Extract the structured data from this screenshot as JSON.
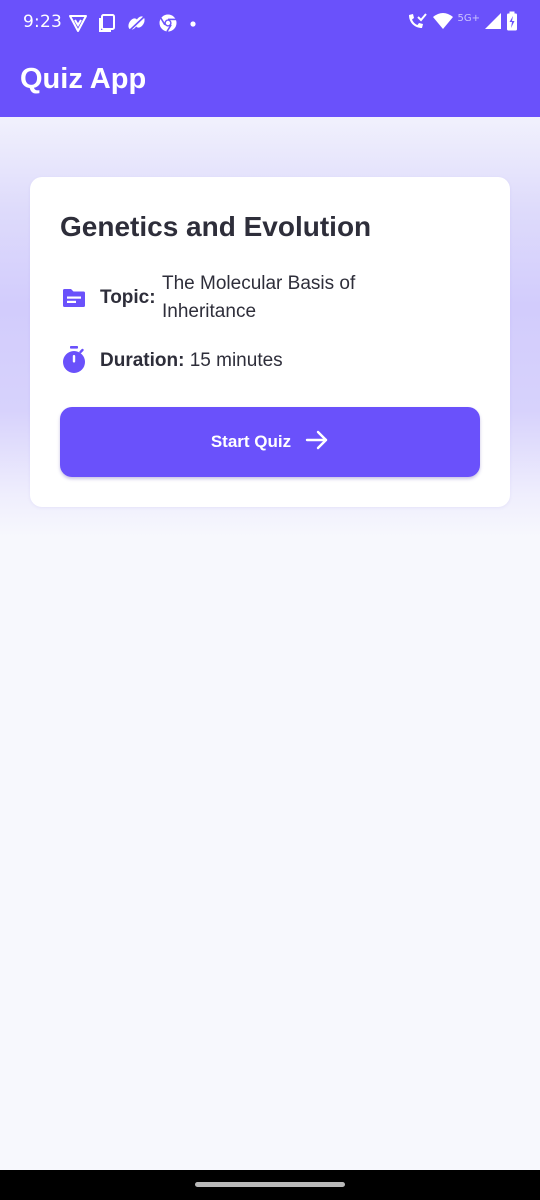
{
  "status_bar": {
    "time": "9:23",
    "network_label": "5G+",
    "left_icons": [
      "vpn-shield-icon",
      "screen-icon",
      "leaf-app-icon",
      "chrome-icon",
      "notification-dot-icon"
    ],
    "right_icons": [
      "wifi-calling-icon",
      "wifi-icon",
      "signal-icon",
      "battery-charging-icon"
    ]
  },
  "app_bar": {
    "title": "Quiz App"
  },
  "quiz_card": {
    "title": "Genetics and Evolution",
    "topic_label": "Topic:",
    "topic_value": "The Molecular Basis of Inheritance",
    "duration_label": "Duration:",
    "duration_value": "15 minutes",
    "start_button_label": "Start Quiz",
    "icons": {
      "topic": "topic-folder-icon",
      "duration": "timer-icon",
      "start": "arrow-right-icon"
    }
  },
  "colors": {
    "primary": "#6A51FB",
    "text": "#2E2E3A",
    "background": "#F7F8FD",
    "card": "#FFFFFF"
  }
}
